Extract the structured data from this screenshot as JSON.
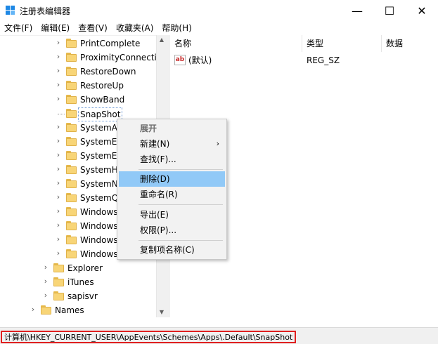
{
  "window": {
    "title": "注册表编辑器",
    "minimize_glyph": "—",
    "maximize_glyph": "☐",
    "close_glyph": "✕"
  },
  "menubar": {
    "items": [
      {
        "label": "文件(F)"
      },
      {
        "label": "编辑(E)"
      },
      {
        "label": "查看(V)"
      },
      {
        "label": "收藏夹(A)"
      },
      {
        "label": "帮助(H)"
      }
    ]
  },
  "tree": {
    "items": [
      {
        "label": "PrintComplete",
        "expanded": false
      },
      {
        "label": "ProximityConnectio",
        "expanded": false
      },
      {
        "label": "RestoreDown",
        "expanded": false
      },
      {
        "label": "RestoreUp",
        "expanded": false
      },
      {
        "label": "ShowBand",
        "expanded": false
      },
      {
        "label": "SnapShot",
        "selected": true
      },
      {
        "label": "SystemAs",
        "expanded": false
      },
      {
        "label": "SystemEx",
        "expanded": false
      },
      {
        "label": "SystemEx",
        "expanded": false
      },
      {
        "label": "SystemHa",
        "expanded": false
      },
      {
        "label": "SystemNo",
        "expanded": false
      },
      {
        "label": "SystemQu",
        "expanded": false
      },
      {
        "label": "Windows",
        "expanded": false
      },
      {
        "label": "Windows",
        "expanded": false
      },
      {
        "label": "Windows",
        "expanded": false
      },
      {
        "label": "Windows",
        "expanded": false
      },
      {
        "label": "Explorer",
        "expanded": false
      },
      {
        "label": "iTunes",
        "expanded": false
      },
      {
        "label": "sapisvr",
        "expanded": false
      },
      {
        "label": "Names",
        "expanded": false
      }
    ]
  },
  "list": {
    "columns": {
      "name": "名称",
      "type": "类型",
      "data": "数据"
    },
    "rows": [
      {
        "icon": "ab",
        "name": "(默认)",
        "type": "REG_SZ",
        "data": ""
      }
    ]
  },
  "context_menu": {
    "expand": "展开",
    "new": "新建(N)",
    "find": "查找(F)...",
    "delete": "删除(D)",
    "rename": "重命名(R)",
    "export": "导出(E)",
    "permissions": "权限(P)...",
    "copy_key_name": "复制项名称(C)",
    "submenu_arrow": "›"
  },
  "statusbar": {
    "path": "计算机\\HKEY_CURRENT_USER\\AppEvents\\Schemes\\Apps\\.Default\\SnapShot"
  },
  "colors": {
    "highlight": "#91c9f7",
    "status_border": "#e02020",
    "folder": "#f8d577"
  }
}
